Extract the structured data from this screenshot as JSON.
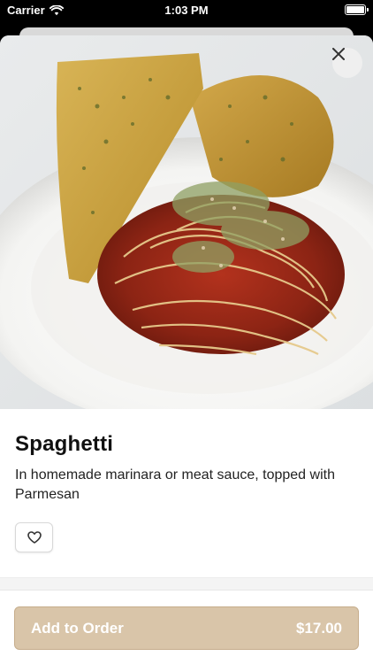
{
  "status_bar": {
    "carrier": "Carrier",
    "time": "1:03 PM",
    "wifi_icon": "wifi-icon",
    "battery_icon": "battery-icon"
  },
  "item": {
    "title": "Spaghetti",
    "description": "In homemade marinara or meat sauce, topped with Parmesan",
    "image_alt": "Spaghetti with garlic bread"
  },
  "actions": {
    "close_icon": "close-icon",
    "favorite_icon": "heart-icon",
    "add_to_order_label": "Add to Order",
    "price": "$17.00"
  },
  "colors": {
    "add_button_bg": "#d9c5a9",
    "add_button_text": "#ffffff"
  }
}
